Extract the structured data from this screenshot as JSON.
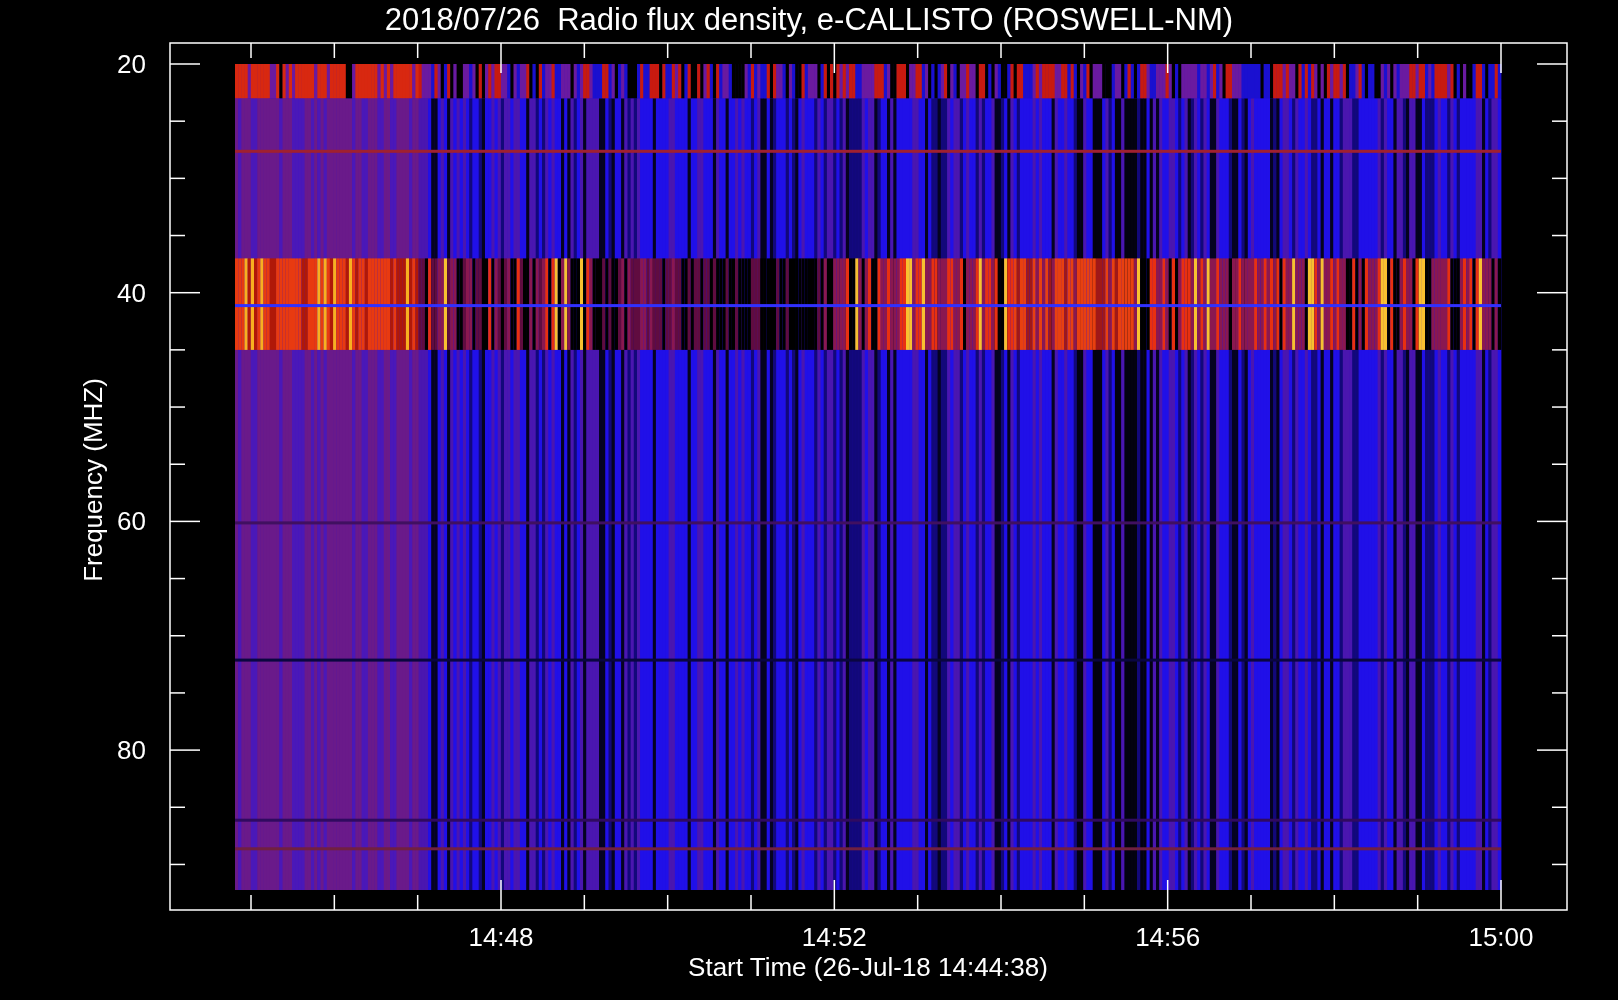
{
  "title": "2018/07/26  Radio flux density, e-CALLISTO (ROSWELL-NM)",
  "y_axis": {
    "label": "Frequency (MHZ)",
    "ticks": [
      "20",
      "40",
      "60",
      "80"
    ]
  },
  "x_axis": {
    "label": "Start Time (26-Jul-18 14:44:38)",
    "ticks": [
      "14:48",
      "14:52",
      "14:56",
      "15:00"
    ]
  }
}
